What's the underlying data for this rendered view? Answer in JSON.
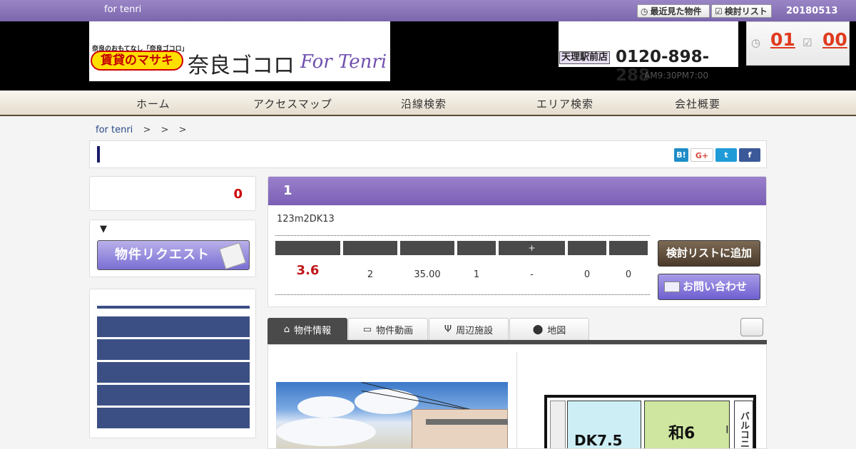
{
  "topbar": {
    "site_name": "for tenri",
    "recent_label": "最近見た物件",
    "consider_label": "検討リスト",
    "date": "20180513"
  },
  "header": {
    "logo_tagline": "奈良のおもてなし「奈良ゴコロ」",
    "logo_badge": "賃貸のマサキ",
    "logo_main": "奈良ゴコロ",
    "logo_script": "For Tenri",
    "branch_label": "天理駅前店",
    "phone": "0120-898-288",
    "hours": "AM9:30PM7:00",
    "recent_count": "01",
    "consider_count": "00"
  },
  "nav": {
    "items": [
      "ホーム",
      "アクセスマップ",
      "沿線検索",
      "エリア検索",
      "会社概要"
    ]
  },
  "breadcrumb": {
    "home": "for tenri",
    "seps": [
      ">",
      ">",
      ">"
    ]
  },
  "share": {
    "hatena": "B!",
    "gplus": "G+",
    "twitter": "t",
    "facebook": "f"
  },
  "sidebar": {
    "count": "0",
    "request_toggle": "▼",
    "request_button": "物件リクエスト"
  },
  "property": {
    "number": "1",
    "summary": "123m2DK13",
    "spec_headers": [
      "",
      "",
      "",
      "",
      "+",
      "",
      ""
    ],
    "rent": "3.6",
    "spec_values": [
      "2",
      "35.00",
      "1",
      "-",
      "0",
      "0"
    ],
    "add_button": "検討リストに追加",
    "contact_button": "お問い合わせ"
  },
  "tabs": {
    "items": [
      "物件情報",
      "物件動画",
      "周辺施設",
      "地図"
    ],
    "active": "物件情報"
  },
  "floorplan": {
    "room1": "DK7.5",
    "room2": "和6",
    "balcony": "バルコニー"
  },
  "colors": {
    "purple": "#7c66ad",
    "navy": "#3c4f85",
    "red": "#c0171a",
    "orange": "#e03a1e"
  }
}
